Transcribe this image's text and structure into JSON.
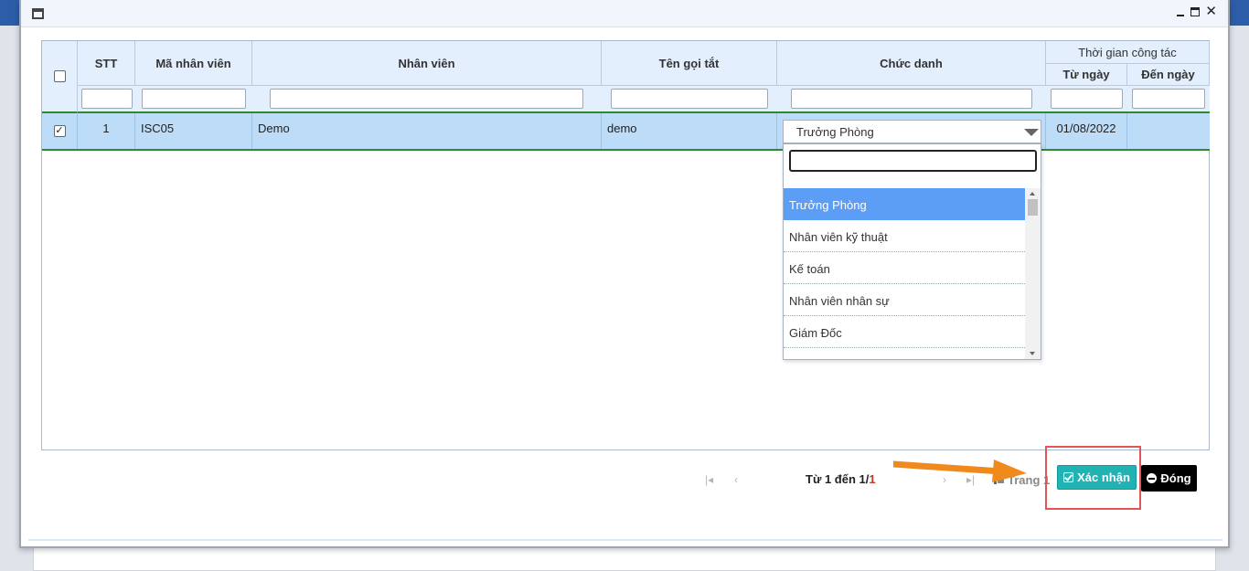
{
  "table": {
    "headers": {
      "stt": "STT",
      "employee_code": "Mã nhân viên",
      "employee": "Nhân viên",
      "short_name": "Tên gọi tắt",
      "position": "Chức danh",
      "work_time": "Thời gian công tác",
      "from_date": "Từ ngày",
      "to_date": "Đến ngày"
    },
    "rows": [
      {
        "checked": true,
        "stt": "1",
        "employee_code": "ISC05",
        "employee": "Demo",
        "short_name": "demo",
        "position": "Trưởng Phòng",
        "from_date": "01/08/2022",
        "to_date": ""
      }
    ]
  },
  "position_dropdown": {
    "selected": "Trưởng Phòng",
    "search_value": "",
    "options": [
      "Trưởng Phòng",
      "Nhân viên kỹ thuật",
      "Kế toán",
      "Nhân viên nhân sự",
      "Giám Đốc"
    ]
  },
  "pager": {
    "range_prefix": "Từ 1 đến 1/",
    "total": "1",
    "page_label": "Trang 1"
  },
  "buttons": {
    "confirm": "Xác nhận",
    "close": "Đóng"
  },
  "colors": {
    "confirm_bg": "#21b3b3",
    "close_bg": "#000000",
    "row_selected": "#bddcf7",
    "option_selected": "#5c9df5",
    "annotation_arrow": "#f08a1c",
    "annotation_box": "#e05555"
  }
}
